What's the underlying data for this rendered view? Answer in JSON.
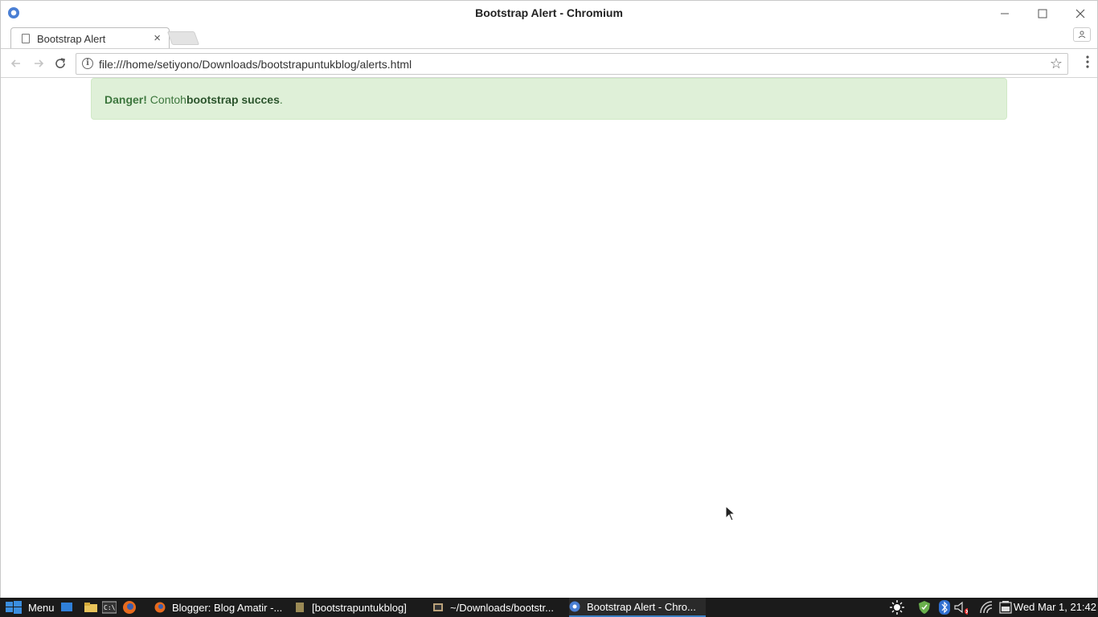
{
  "window": {
    "title": "Bootstrap Alert - Chromium"
  },
  "tabs": [
    {
      "label": "Bootstrap Alert",
      "close": "×"
    }
  ],
  "omnibox": {
    "info_glyph": "i",
    "url": "file:///home/setiyono/Downloads/bootstrapuntukblog/alerts.html",
    "star": "☆"
  },
  "page": {
    "alert": {
      "strong": "Danger!",
      "text1": " Contoh",
      "bold": "bootstrap succes",
      "text2": ".",
      "bg_color": "#dff0d8",
      "text_color": "#3c763d"
    }
  },
  "taskbar": {
    "menu_label": "Menu",
    "tasks": [
      {
        "label": "Blogger: Blog Amatir -...",
        "icon": "firefox-icon"
      },
      {
        "label": "[bootstrapuntukblog]",
        "icon": "folder-icon"
      },
      {
        "label": "~/Downloads/bootstr...",
        "icon": "editor-icon"
      },
      {
        "label": "Bootstrap Alert - Chro...",
        "icon": "chromium-icon"
      }
    ],
    "clock": "Wed Mar  1, 21:42"
  }
}
